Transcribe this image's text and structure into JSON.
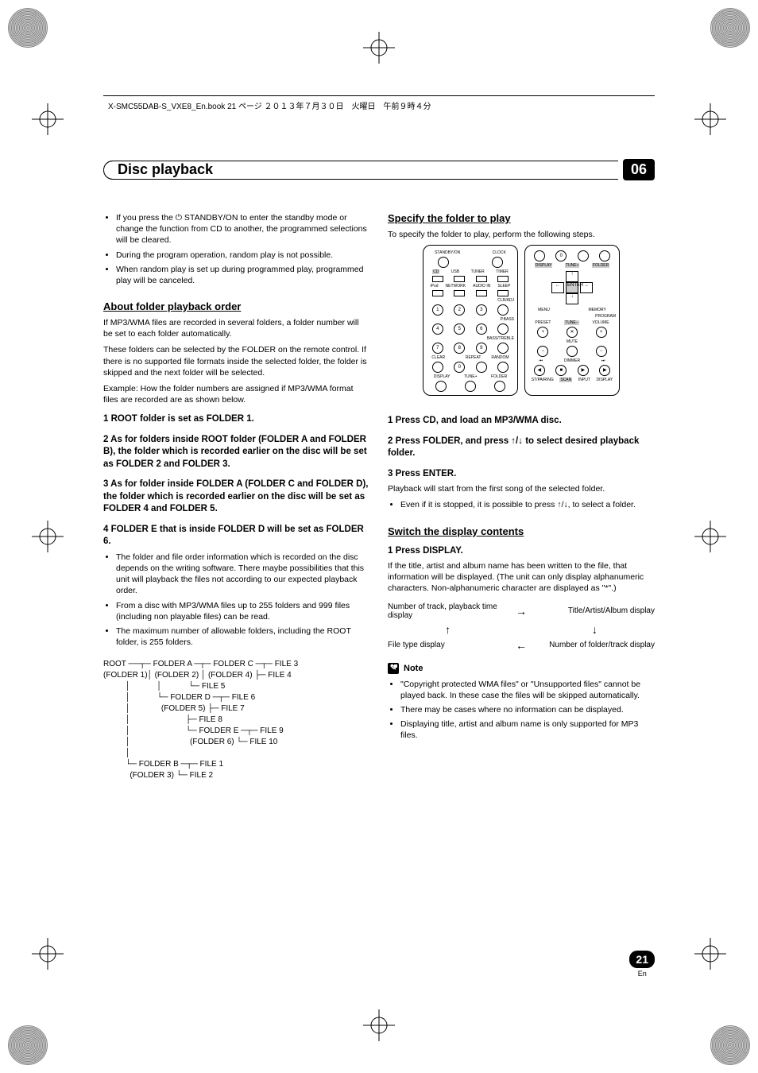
{
  "header": {
    "running": "X-SMC55DAB-S_VXE8_En.book  21 ページ  ２０１３年７月３０日　火曜日　午前９時４分"
  },
  "chapter": {
    "title": "Disc playback",
    "number": "06"
  },
  "left": {
    "intro_bullets": [
      "If you press the ⏻ STANDBY/ON to enter the standby mode or change the function from CD to another, the programmed selections will be cleared.",
      "During the program operation, random play is not possible.",
      "When random play is set up during programmed play, programmed play will be canceled."
    ],
    "sec1_h": "About folder playback order",
    "sec1_p1": "If MP3/WMA files are recorded in several folders, a folder number will be set to each folder automatically.",
    "sec1_p2": "These folders can be selected by the FOLDER on the remote control. If there is no supported file formats inside the selected folder, the folder is skipped and the next folder will be selected.",
    "sec1_p3": "Example: How the folder numbers are assigned if MP3/WMA format files are recorded are as shown below.",
    "step1": "1    ROOT folder is set as FOLDER 1.",
    "step2": "2    As for folders inside ROOT folder (FOLDER A and FOLDER B), the folder which is recorded earlier on the disc will be set as FOLDER 2 and FOLDER 3.",
    "step3": "3    As for folder inside FOLDER A (FOLDER C and FOLDER D), the folder which is recorded earlier on the disc will be set as FOLDER 4 and FOLDER 5.",
    "step4": "4    FOLDER E that is inside FOLDER D will be set as FOLDER 6.",
    "step4_bullets": [
      "The folder and file order information which is recorded on the disc depends on the writing software. There maybe possibilities that this unit will playback the files not according to our expected playback order.",
      "From a disc with MP3/WMA files up to 255 folders and 999 files (including non playable files) can be read.",
      "The maximum number of allowable folders, including the ROOT folder, is 255 folders."
    ],
    "tree": "ROOT ──┬─ FOLDER A ─┬─ FOLDER C ─┬─ FILE 3\n(FOLDER 1)│ (FOLDER 2) │ (FOLDER 4) ├─ FILE 4\n          │            │            └─ FILE 5\n          │            └─ FOLDER D ─┬─ FILE 6\n          │              (FOLDER 5) ├─ FILE 7\n          │                         ├─ FILE 8\n          │                         └─ FOLDER E ─┬─ FILE 9\n          │                           (FOLDER 6) └─ FILE 10\n          │\n          └─ FOLDER B ─┬─ FILE 1\n            (FOLDER 3) └─ FILE 2"
  },
  "right": {
    "sec2_h": "Specify the folder to play",
    "sec2_p1": "To specify the folder to play, perform the following steps.",
    "r_step1": "1    Press CD, and load an MP3/WMA disc.",
    "r_step2": "2    Press FOLDER, and press ↑/↓ to select desired playback folder.",
    "r_step3": "3    Press ENTER.",
    "r_step3_p": "Playback will start from the first song of the selected folder.",
    "r_step3_bullets": [
      "Even if it is stopped, it is possible to press ↑/↓, to select a folder."
    ],
    "sec3_h": "Switch the display contents",
    "sec3_step1": "1    Press DISPLAY.",
    "sec3_p1": "If the title, artist and album name has been written to the file, that information will be displayed. (The unit can only display alphanumeric characters. Non-alphanumeric character are displayed as \"*\".)",
    "flow": {
      "a": "Number of track, playback time display",
      "b": "Title/Artist/Album display",
      "c": "File type display",
      "d": "Number of folder/track display"
    },
    "note_label": "Note",
    "note_bullets": [
      "\"Copyright protected WMA files\" or \"Unsupported files\" cannot be played back. In these case the files will be skipped automatically.",
      "There may be cases where no information can be displayed.",
      "Displaying title, artist and album name is only supported for MP3 files."
    ]
  },
  "remote_labels": {
    "standby": "STANDBY/ON",
    "clock": "CLOCK",
    "cd": "CD",
    "usb": "USB",
    "tuner": "TUNER",
    "timer": "TIMER",
    "ipod": "iPod",
    "network": "NETWORK",
    "audioin": "AUDIO IN",
    "sleep": "SLEEP",
    "clradj": "CLR/ADJ",
    "pbass": "P.BASS",
    "bass_treble": "BASS/TREBLE",
    "clear": "CLEAR",
    "repeat": "REPEAT",
    "random": "RANDOM",
    "display": "DISPLAY",
    "tune_minus": "TUNE−",
    "tune_plus": "TUNE+",
    "folder": "FOLDER",
    "enter": "ENTER",
    "menu": "MENU",
    "memory": "MEMORY",
    "program": "PROGRAM",
    "preset": "PRESET",
    "volume": "VOLUME",
    "mute": "MUTE",
    "dimmer": "DIMMER",
    "stpairing": "ST/PAIRING",
    "scan": "SCAN",
    "input": "INPUT"
  },
  "footer": {
    "page": "21",
    "lang": "En"
  }
}
